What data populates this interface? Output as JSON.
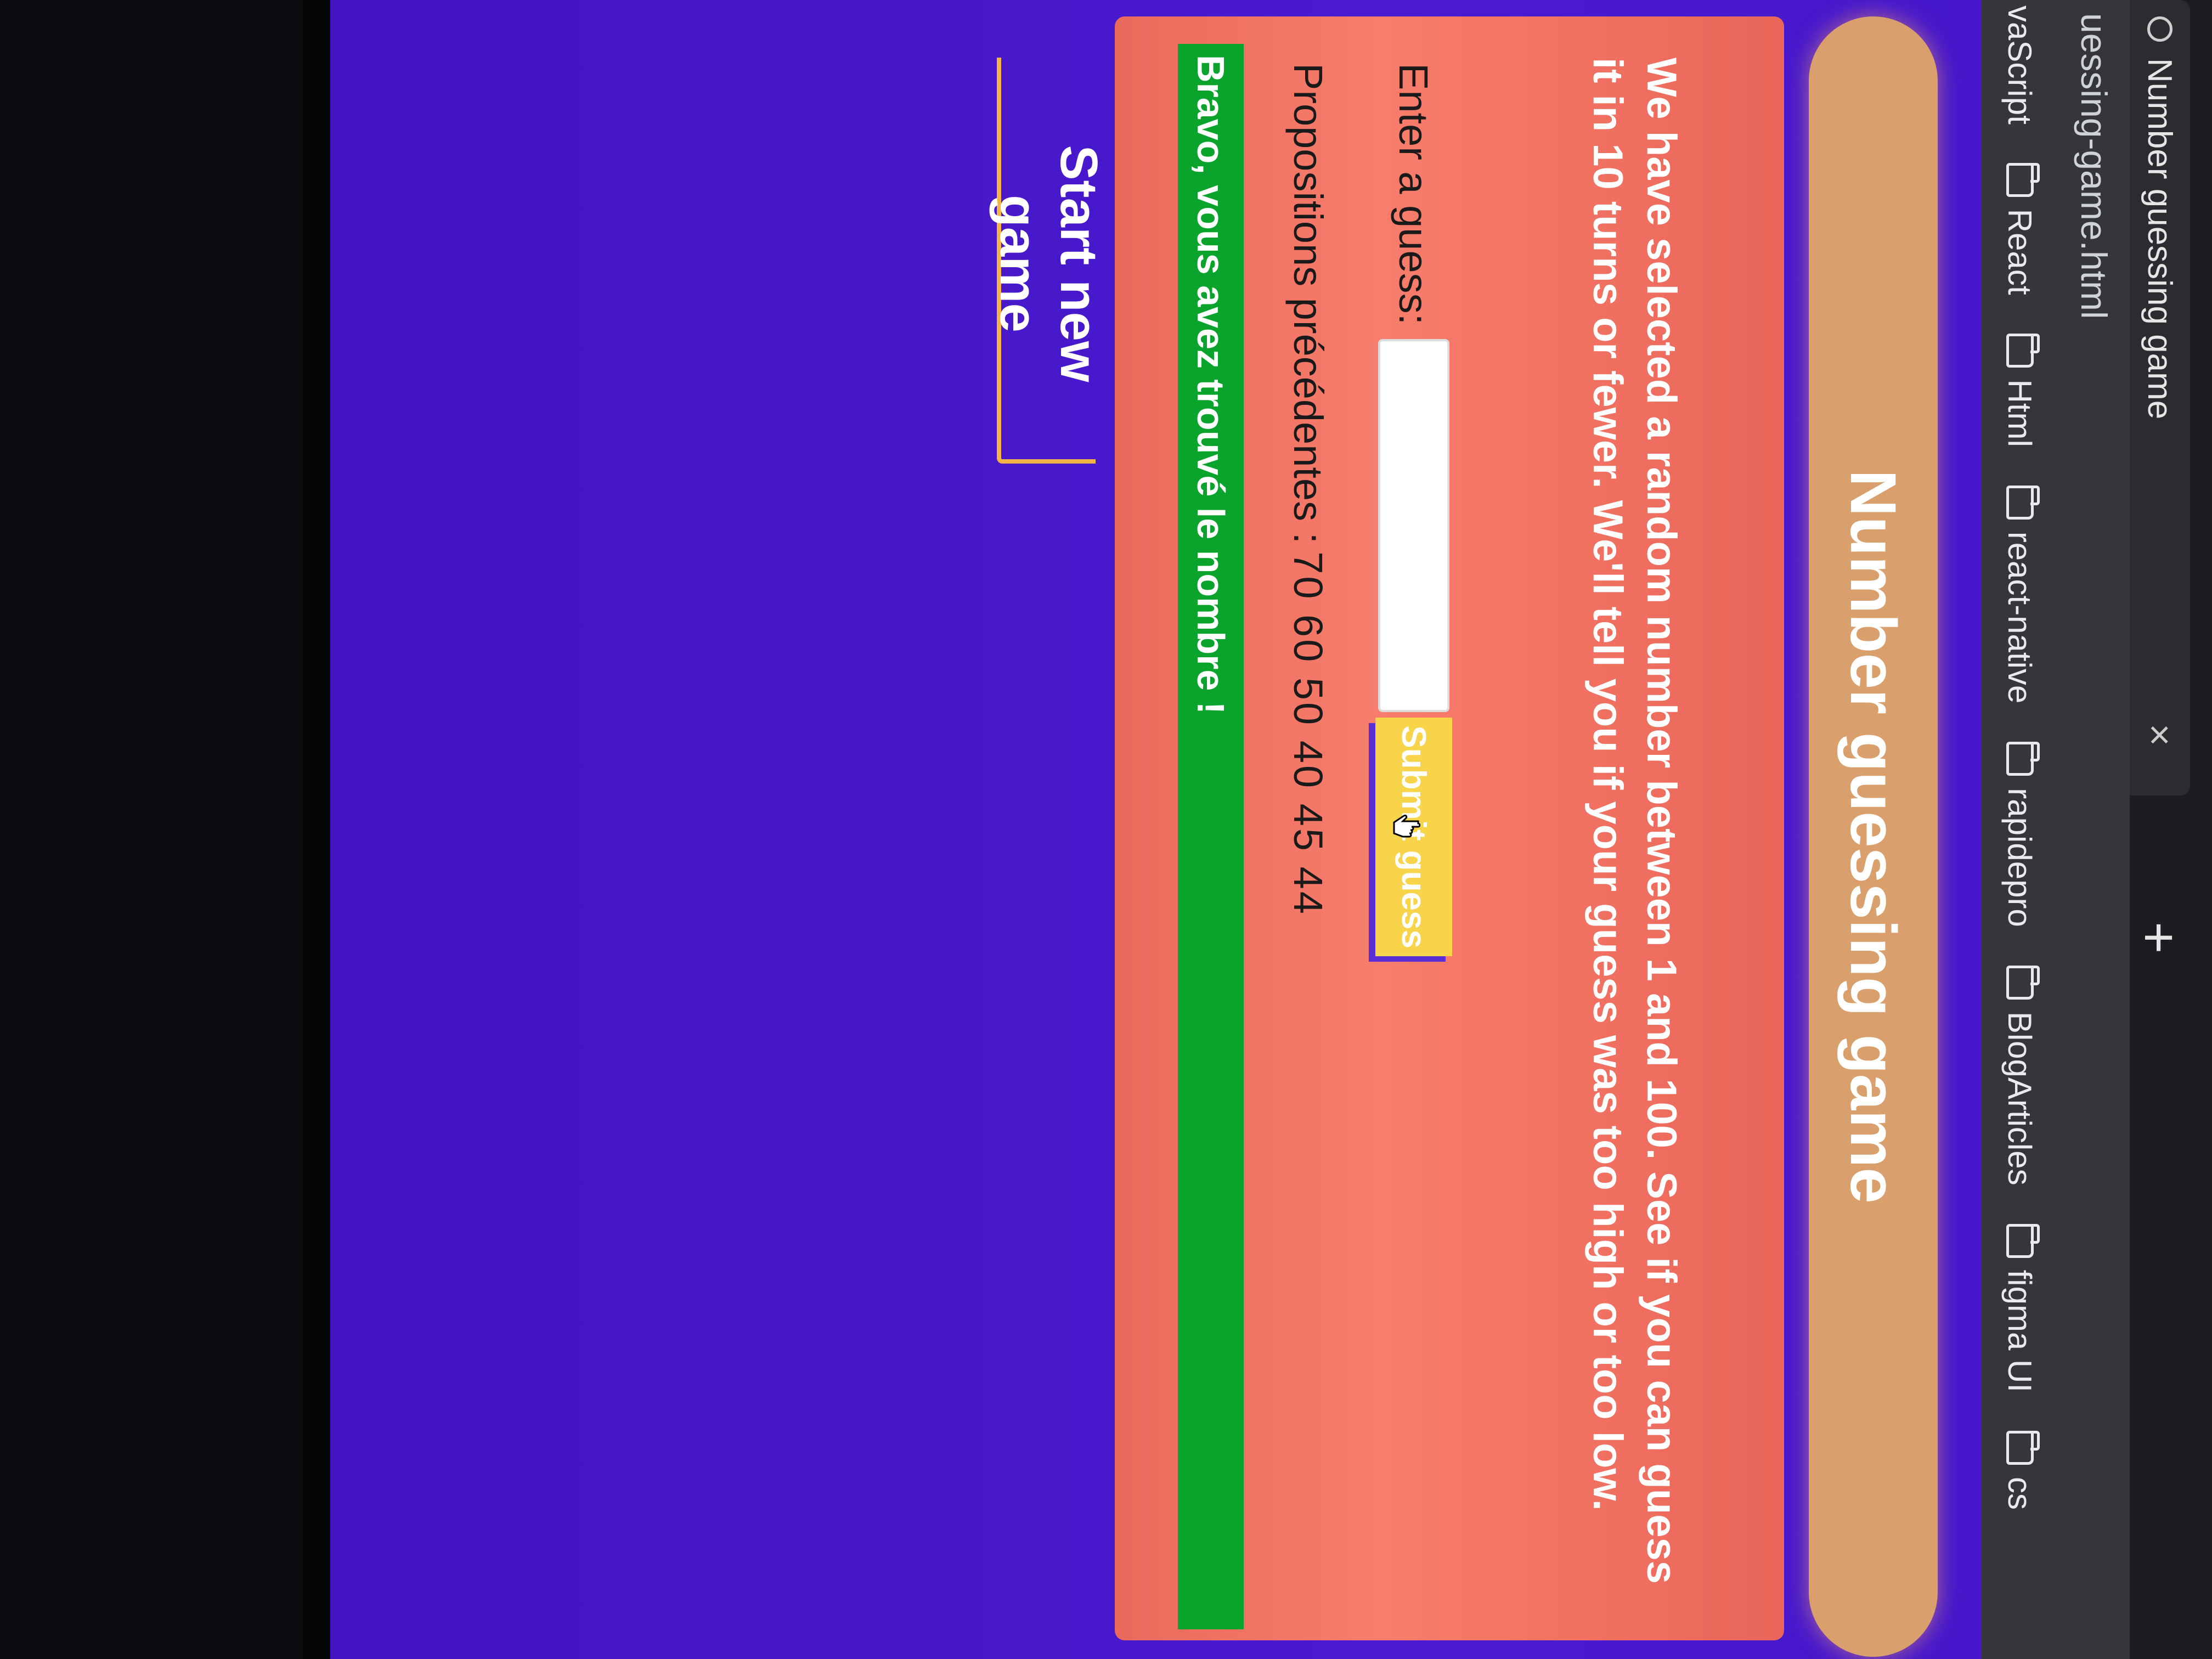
{
  "browser": {
    "tab_title": "Number guessing game",
    "new_tab_icon": "plus-icon",
    "close_icon": "close-icon",
    "address": "uessing-game.html",
    "bookmarks": [
      {
        "label": "vaScript",
        "icon": "none"
      },
      {
        "label": "React",
        "icon": "folder-icon"
      },
      {
        "label": "Html",
        "icon": "folder-icon"
      },
      {
        "label": "react-native",
        "icon": "folder-icon"
      },
      {
        "label": "rapidepro",
        "icon": "folder-icon"
      },
      {
        "label": "BlogArticles",
        "icon": "folder-icon"
      },
      {
        "label": "figma UI",
        "icon": "folder-icon"
      },
      {
        "label": "cs",
        "icon": "folder-icon"
      }
    ]
  },
  "page": {
    "title": "Number guessing game",
    "intro": "We have selected a random number between 1 and 100. See if you can guess it in 10 turns or fewer. We'll tell you if your guess was too high or too low.",
    "guess_label": "Enter a guess:",
    "guess_value": "",
    "submit_label": "Submit guess",
    "history_label": "Propositions précédentes :",
    "history_values": "70 60 50 40 45 44",
    "result_message": "Bravo, vous avez trouvé le nombre !",
    "new_game_label": "Start new game"
  },
  "colors": {
    "background": "#4a1bcc",
    "title_banner": "#d9a06e",
    "card": "#f47564",
    "submit": "#f7d44a",
    "success": "#0aa42c",
    "new_game_border": "#f2b347"
  }
}
